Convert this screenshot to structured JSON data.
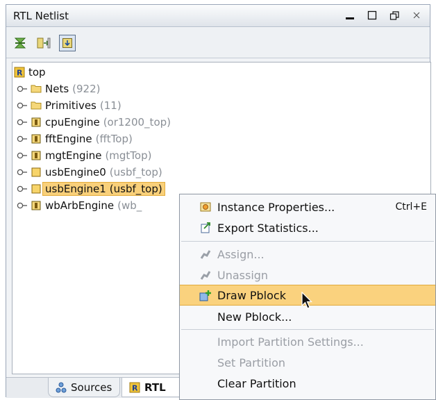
{
  "window": {
    "title": "RTL Netlist",
    "controls": {
      "minimize": "minimize-icon",
      "maximize": "maximize-icon",
      "restore": "restore-icon",
      "close": "close-icon"
    }
  },
  "toolbar": {
    "buttons": [
      "collapse-all-icon",
      "expand-all-icon",
      "show-hierarchy-icon"
    ]
  },
  "tree": {
    "root": "top",
    "items": [
      {
        "name": "Nets",
        "sub": "(922)",
        "icon": "folder-icon"
      },
      {
        "name": "Primitives",
        "sub": "(11)",
        "icon": "folder-icon"
      },
      {
        "name": "cpuEngine",
        "sub": "(or1200_top)",
        "icon": "module-icon"
      },
      {
        "name": "fftEngine",
        "sub": "(fftTop)",
        "icon": "module-icon"
      },
      {
        "name": "mgtEngine",
        "sub": "(mgtTop)",
        "icon": "module-icon"
      },
      {
        "name": "usbEngine0",
        "sub": "(usbf_top)",
        "icon": "box-icon"
      },
      {
        "name": "usbEngine1",
        "sub": "(usbf_top)",
        "icon": "box-icon",
        "selected": true
      },
      {
        "name": "wbArbEngine",
        "sub": "(wb_",
        "icon": "module-icon"
      }
    ]
  },
  "tabs": {
    "sources": "Sources",
    "rtl": "RTL"
  },
  "context_menu": {
    "instance_properties": "Instance Properties...",
    "instance_properties_accel": "Ctrl+E",
    "export_statistics": "Export Statistics...",
    "assign": "Assign...",
    "unassign": "Unassign",
    "draw_pblock": "Draw Pblock",
    "new_pblock": "New Pblock...",
    "import_partition": "Import Partition Settings...",
    "set_partition": "Set Partition",
    "clear_partition": "Clear Partition"
  },
  "colors": {
    "selection": "#f9d07a",
    "menu_hover": "#fad27e",
    "disabled_text": "#9a9ea5"
  }
}
